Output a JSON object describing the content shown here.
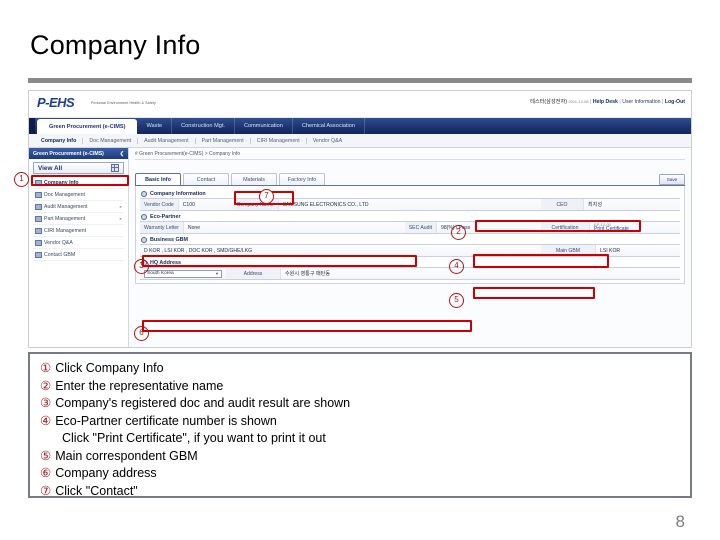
{
  "slide": {
    "title": "Company Info",
    "page_number": "8"
  },
  "app": {
    "logo": "P-EHS",
    "logo_sub": "Personal Environment Health & Safety",
    "header_right": {
      "account_kr": "테스터(삼성전자)",
      "account_id": "2011-12-08",
      "help_desk": "Help Desk",
      "user_information": "User Information",
      "logout": "Log-Out",
      "separator": "|"
    },
    "nav": [
      {
        "label": "Green Procurement (e-CIMS)",
        "active": true
      },
      {
        "label": "Waste",
        "active": false
      },
      {
        "label": "Construction Mgt.",
        "active": false
      },
      {
        "label": "Communication",
        "active": false
      },
      {
        "label": "Chemical Association",
        "active": false
      }
    ],
    "subnav": [
      {
        "label": "Company Info",
        "active": true
      },
      {
        "label": "Doc Management",
        "active": false
      },
      {
        "label": "Audit Management",
        "active": false
      },
      {
        "label": "Part Management",
        "active": false
      },
      {
        "label": "CIRI Management",
        "active": false
      },
      {
        "label": "Vendor Q&A",
        "active": false
      }
    ],
    "sidebar": {
      "header": "Green Procurement (e-CIMS)",
      "collapse_icon": "chevron-left",
      "view_all": "View All",
      "items": [
        {
          "label": "Company Info",
          "selected": true,
          "has_arrow": false
        },
        {
          "label": "Doc Management",
          "selected": false,
          "has_arrow": false
        },
        {
          "label": "Audit Management",
          "selected": false,
          "has_arrow": true
        },
        {
          "label": "Part Management",
          "selected": false,
          "has_arrow": true
        },
        {
          "label": "CIRI Management",
          "selected": false,
          "has_arrow": false
        },
        {
          "label": "Vendor Q&A",
          "selected": false,
          "has_arrow": false
        },
        {
          "label": "Contact GBM",
          "selected": false,
          "has_arrow": false
        }
      ]
    },
    "content": {
      "breadcrumb": "# Green Procurement(e-CIMS) > Company Info",
      "save_button": "Save",
      "tabs": [
        {
          "label": "Basic Info",
          "active": true
        },
        {
          "label": "Contact",
          "active": false
        },
        {
          "label": "Materials",
          "active": false
        },
        {
          "label": "Factory Info",
          "active": false
        }
      ],
      "company_information": {
        "section_title": "Company Information",
        "vendor_code_label": "Vendor Code",
        "vendor_code_value": "C100",
        "company_name_label": "Company Name",
        "company_name_value": "SAMSUNG ELECTRONICS CO., LTD",
        "ceo_label": "CEO",
        "ceo_value": "최지성"
      },
      "eco_partner": {
        "section_title": "Eco-Partner",
        "warranty_label": "Warranty Letter",
        "warranty_value": "None",
        "sec_audit_label": "SEC Audit",
        "sec_audit_value": "98(%)  / Pass",
        "certification_label": "Certification",
        "certification_number": "EP-12-00",
        "print_certificate_link": "Print Certificate"
      },
      "business_gbm": {
        "section_title": "Business GBM",
        "value": "D KOR , LSI KOR , DOC KOR , SMD/GHE/LKG",
        "main_gbm_label": "Main GBM",
        "main_gbm_value": "LSI KOR"
      },
      "hq_address": {
        "section_title": "HQ Address",
        "country_value": "South Korea",
        "address_label": "Address",
        "address_value": "수원시 영통구 매탄동"
      }
    }
  },
  "annotations": {
    "markers": [
      "1",
      "2",
      "3",
      "4",
      "5",
      "6",
      "7"
    ]
  },
  "legend": {
    "lines": [
      {
        "num": "①",
        "text": "Click Company Info",
        "indent": false
      },
      {
        "num": "②",
        "text": "Enter the representative name",
        "indent": false
      },
      {
        "num": "③",
        "text": "Company's registered doc and audit result are shown",
        "indent": false
      },
      {
        "num": "④",
        "text": "Eco-Partner certificate number is shown",
        "indent": false
      },
      {
        "num": "",
        "text": "Click \"Print Certificate\", if you want to print it out",
        "indent": true
      },
      {
        "num": "⑤",
        "text": "Main correspondent GBM",
        "indent": false
      },
      {
        "num": "⑥",
        "text": "Company address",
        "indent": false
      },
      {
        "num": "⑦",
        "text": "Click \"Contact\"",
        "indent": false
      }
    ]
  },
  "colors": {
    "annotation_red": "#cc0000",
    "nav_blue": "#1d3572",
    "logo_blue": "#1c3f94"
  }
}
